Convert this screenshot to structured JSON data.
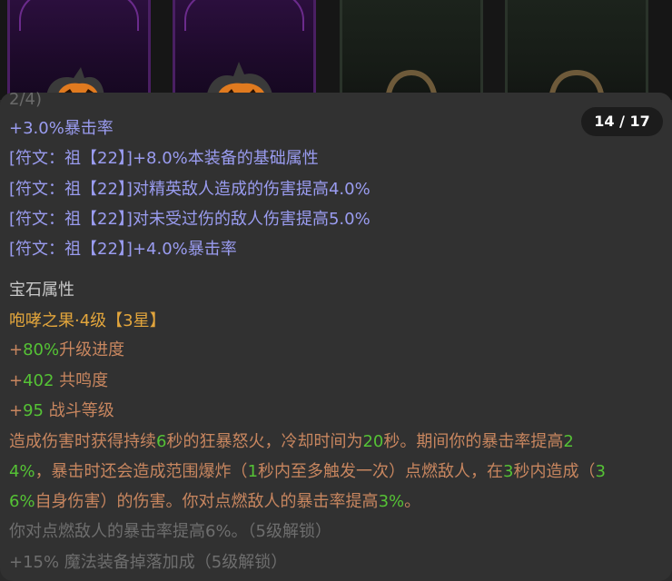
{
  "thumbnails": [
    {
      "name": "item-slot-1",
      "style": "purple"
    },
    {
      "name": "item-slot-2",
      "style": "purple"
    },
    {
      "name": "item-slot-3",
      "style": "dark"
    },
    {
      "name": "item-slot-4",
      "style": "dark"
    }
  ],
  "pager": "14 / 17",
  "cut_line": "2/4)",
  "stats": [
    "+3.0%暴击率",
    "[符文：祖【22】]+8.0%本装备的基础属性",
    "[符文：祖【22】]对精英敌人造成的伤害提高4.0%",
    "[符文：祖【22】]对未受过伤的敌人伤害提高5.0%",
    "[符文：祖【22】]+4.0%暴击率"
  ],
  "gem_section": {
    "title": "宝石属性",
    "gem_name": "咆哮之果·4级【3星】",
    "upgrade": {
      "plus": "+",
      "value": "80%",
      "label": "升级进度"
    },
    "resonance": {
      "plus": "+",
      "value": "402",
      "label": " 共鸣度"
    },
    "battle_level": {
      "plus": "+",
      "value": "95",
      "label": " 战斗等级"
    },
    "effect": {
      "l1a": "造成伤害时获得持续",
      "l1b": "6",
      "l1c": "秒的狂暴怒火，冷却时间为",
      "l1d": "20",
      "l1e": "秒。期间你的暴击率提高",
      "l1f": "2",
      "l2a": "4%",
      "l2b": "，暴击时还会造成范围爆炸（",
      "l2c": "1",
      "l2d": "秒内至多触发一次）点燃敌人，在",
      "l2e": "3",
      "l2f": "秒内造成（",
      "l2g": "3",
      "l3a": "6%",
      "l3b": "自身伤害）的伤害。你对点燃敌人的暴击率提高",
      "l3c": "3%",
      "l3d": "。"
    },
    "locked": [
      "你对点燃敌人的暴击率提高6%。（5级解锁）",
      "+15% 魔法装备掉落加成（5级解锁）"
    ]
  },
  "colors": {
    "stat_blue": "#9a9cf0",
    "gem_orange": "#e2a53c",
    "effect_brown": "#c8865f",
    "value_green": "#55c235",
    "locked_gray": "#6e6e6e"
  }
}
